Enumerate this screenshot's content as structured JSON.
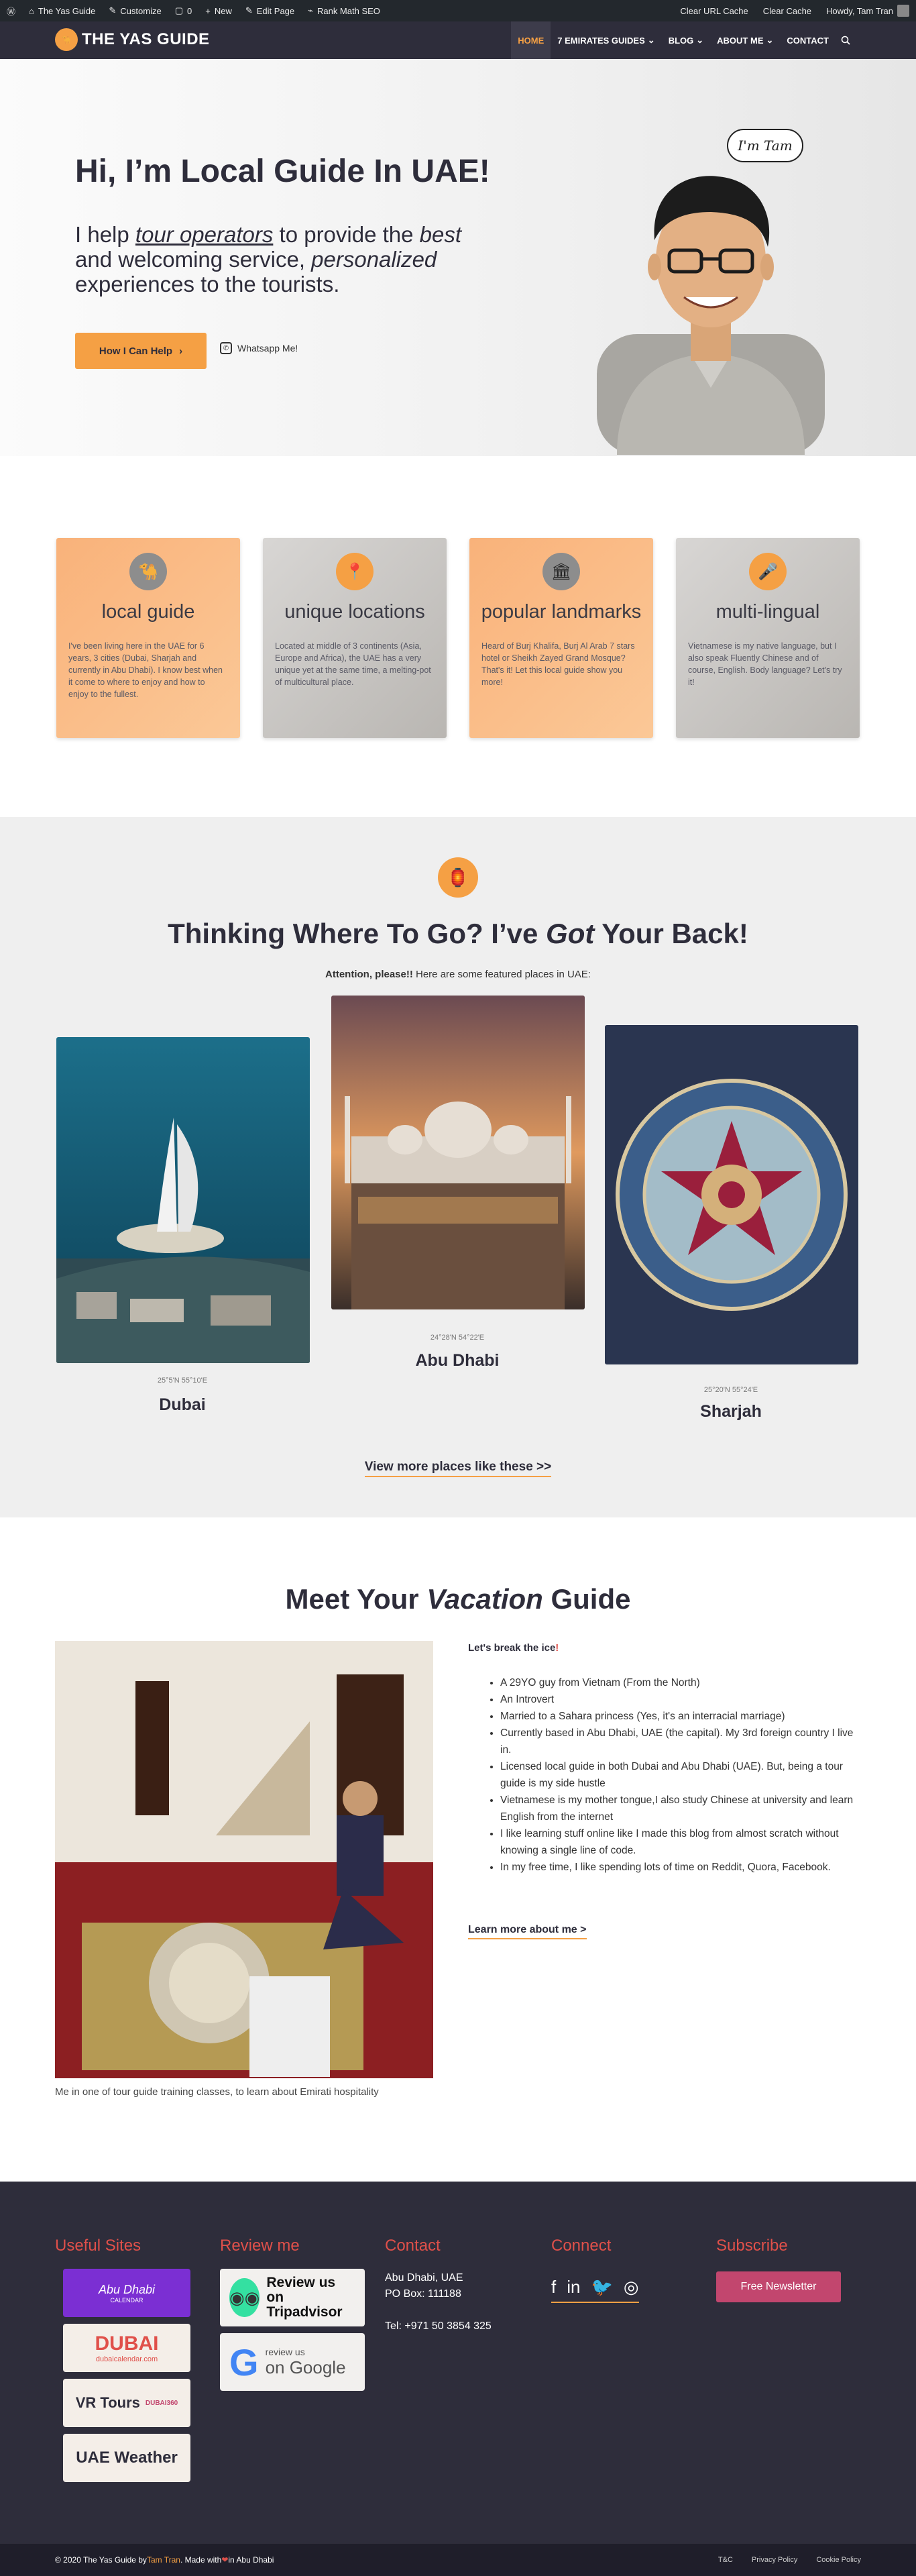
{
  "admin_bar": {
    "site_name": "The Yas Guide",
    "customize": "Customize",
    "comments": "0",
    "new": "New",
    "edit_page": "Edit Page",
    "rank_math": "Rank Math SEO",
    "clear_url_cache": "Clear URL Cache",
    "clear_cache": "Clear Cache",
    "howdy": "Howdy, Tam Tran"
  },
  "header": {
    "logo_text": "THE YAS GUIDE",
    "nav": [
      {
        "label": "HOME",
        "active": true
      },
      {
        "label": "7 EMIRATES GUIDES",
        "dropdown": true
      },
      {
        "label": "BLOG",
        "dropdown": true
      },
      {
        "label": "ABOUT ME",
        "dropdown": true
      },
      {
        "label": "CONTACT"
      }
    ]
  },
  "hero": {
    "title": "Hi, I’m Local Guide In UAE!",
    "sub_1": "I help ",
    "sub_link": "tour operators",
    "sub_2": " to provide the ",
    "sub_best": "best",
    "sub_3": " and welcoming service, ",
    "sub_personalized": "personalized",
    "sub_4": " experiences to the tourists.",
    "cta": "How I Can Help",
    "whatsapp": "Whatsapp Me!",
    "bubble": "I'm Tam"
  },
  "features": [
    {
      "title": "local guide",
      "text": "I've been living here in the UAE for 6 years, 3 cities (Dubai, Sharjah and currently in Abu Dhabi). I know best when it come to where to enjoy and how to enjoy to the fullest.",
      "icon": "camel-icon",
      "style": "orange"
    },
    {
      "title": "unique locations",
      "text": "Located at middle of 3 continents (Asia, Europe and Africa), the UAE has a very unique yet at the same time, a melting-pot of multicultural place.",
      "icon": "location-pin-icon",
      "style": "grey"
    },
    {
      "title": "popular landmarks",
      "text": "Heard of Burj Khalifa, Burj Al Arab 7 stars hotel or Sheikh Zayed Grand Mosque? That's it! Let this local guide show you more!",
      "icon": "landmark-icon",
      "style": "orange"
    },
    {
      "title": "multi-lingual",
      "text": "Vietnamese is my native language, but I also speak Fluently Chinese and of course, English. Body language? Let's try it!",
      "icon": "microphone-icon",
      "style": "grey"
    }
  ],
  "places": {
    "title_1": "Thinking Where To Go? I’ve ",
    "title_em": "Got",
    "title_2": " Your Back!",
    "attention": "Attention, please!!",
    "attention_rest": " Here are some featured places in UAE:",
    "items": [
      {
        "name": "Dubai",
        "coord": "25°5'N 55°10'E"
      },
      {
        "name": "Abu Dhabi",
        "coord": "24°28'N 54°22'E"
      },
      {
        "name": "Sharjah",
        "coord": "25°20'N 55°24'E"
      }
    ],
    "view_more": "View more places like these >>"
  },
  "guide": {
    "title_1": "Meet Your ",
    "title_em": "Vacation",
    "title_2": " Guide",
    "icebreak": "Let's break the ice",
    "icebreak_end": "!",
    "bullets": [
      "A 29YO guy from Vietnam (From the North)",
      "An Introvert",
      "Married to a Sahara princess (Yes, it's an interracial marriage)",
      "Currently based in Abu Dhabi, UAE (the capital). My 3rd foreign country I live in.",
      "Licensed local guide in both Dubai and Abu Dhabi (UAE). But, being a tour guide is my side hustle",
      "Vietnamese is my mother tongue,I also study Chinese at university and learn English from the internet",
      "I like learning stuff online like I made this blog from almost scratch without knowing a single line of code.",
      "In my free time, I like spending lots of time on Reddit, Quora, Facebook."
    ],
    "learn_more": "Learn more about me >",
    "caption": "Me in one of tour guide training classes, to learn about Emirati hospitality"
  },
  "footer": {
    "useful_sites": "Useful Sites",
    "review_me": "Review me",
    "contact": "Contact",
    "connect": "Connect",
    "subscribe": "Subscribe",
    "badges": [
      {
        "title": "Abu Dhabi",
        "sub": "CALENDAR",
        "bg": "#7b2fd3",
        "color": "#ffffff"
      },
      {
        "title": "DUBAI",
        "sub": "dubaicalendar.com",
        "bg": "#f4eee8",
        "color": "#e0504a"
      },
      {
        "title": "VR Tours",
        "sub": "DUBAI360",
        "bg": "#f4eee8",
        "color": "#2e2d3b"
      },
      {
        "title": "UAE Weather",
        "sub": "",
        "bg": "#f4eee8",
        "color": "#2e2d3b"
      }
    ],
    "review_tripadvisor": "Review us on Tripadvisor",
    "review_google_top": "review us",
    "review_google": "on Google",
    "contact_lines": [
      "Abu Dhabi, UAE",
      "PO Box: 111188"
    ],
    "phone": "Tel: +971 50 3854 325",
    "newsletter": "Free Newsletter",
    "copyright_1": "© 2020 The Yas Guide by ",
    "copyright_name": "Tam Tran",
    "copyright_2": ". Made with ",
    "copyright_3": " in Abu Dhabi",
    "bottom_links": [
      "T&C",
      "Privacy Policy",
      "Cookie Policy"
    ]
  }
}
